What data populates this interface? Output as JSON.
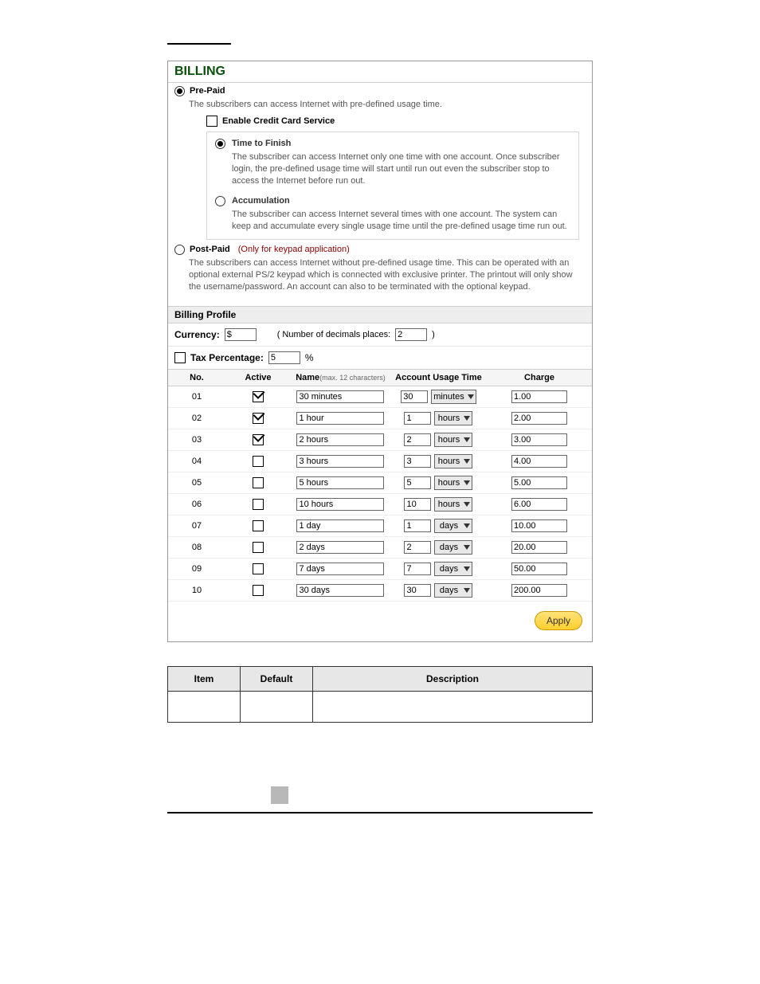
{
  "title": "BILLING",
  "prepaid": {
    "selected": true,
    "label": "Pre-Paid",
    "desc": "The subscribers can access Internet with pre-defined usage time.",
    "cc_enable_label": "Enable Credit Card Service",
    "cc_checked": false,
    "time_to_finish": {
      "selected": true,
      "label": "Time to Finish",
      "desc": "The subscriber can access Internet only one time with one account.  Once subscriber login, the pre-defined usage time will start until run out even the subscriber stop to access the Internet before run out."
    },
    "accumulation": {
      "selected": false,
      "label": "Accumulation",
      "desc": "The subscriber can access Internet several times with one account.  The system can keep and accumulate every single usage time until the pre-defined usage time run out."
    }
  },
  "postpaid": {
    "selected": false,
    "label": "Post-Paid",
    "note": "(Only for keypad application)",
    "desc": "The subscribers can access Internet without pre-defined usage time. This can be operated with an optional external PS/2 keypad which is connected with exclusive printer. The printout will only show the username/password. An account can also to be terminated with the optional keypad."
  },
  "billing_profile_label": "Billing Profile",
  "currency_label": "Currency:",
  "currency_value": "$",
  "decimals_pre": "( Number of decimals places:",
  "decimals_value": "2",
  "decimals_post": ")",
  "tax_checked": false,
  "tax_label": "Tax Percentage:",
  "tax_value": "5",
  "tax_suffix": "%",
  "columns": {
    "no": "No.",
    "active": "Active",
    "name": "Name",
    "name_sub": "(max. 12 characters)",
    "usage": "Account Usage Time",
    "charge": "Charge"
  },
  "rows": [
    {
      "no": "01",
      "active": true,
      "name": "30 minutes",
      "qty": "30",
      "unit": "minutes",
      "charge": "1.00"
    },
    {
      "no": "02",
      "active": true,
      "name": "1 hour",
      "qty": "1",
      "unit": "hours",
      "charge": "2.00"
    },
    {
      "no": "03",
      "active": true,
      "name": "2 hours",
      "qty": "2",
      "unit": "hours",
      "charge": "3.00"
    },
    {
      "no": "04",
      "active": false,
      "name": "3 hours",
      "qty": "3",
      "unit": "hours",
      "charge": "4.00"
    },
    {
      "no": "05",
      "active": false,
      "name": "5 hours",
      "qty": "5",
      "unit": "hours",
      "charge": "5.00"
    },
    {
      "no": "06",
      "active": false,
      "name": "10 hours",
      "qty": "10",
      "unit": "hours",
      "charge": "6.00"
    },
    {
      "no": "07",
      "active": false,
      "name": "1 day",
      "qty": "1",
      "unit": "days",
      "charge": "10.00"
    },
    {
      "no": "08",
      "active": false,
      "name": "2 days",
      "qty": "2",
      "unit": "days",
      "charge": "20.00"
    },
    {
      "no": "09",
      "active": false,
      "name": "7 days",
      "qty": "7",
      "unit": "days",
      "charge": "50.00"
    },
    {
      "no": "10",
      "active": false,
      "name": "30 days",
      "qty": "30",
      "unit": "days",
      "charge": "200.00"
    }
  ],
  "apply_label": "Apply",
  "desc_table": {
    "item": "Item",
    "default": "Default",
    "description": "Description"
  }
}
